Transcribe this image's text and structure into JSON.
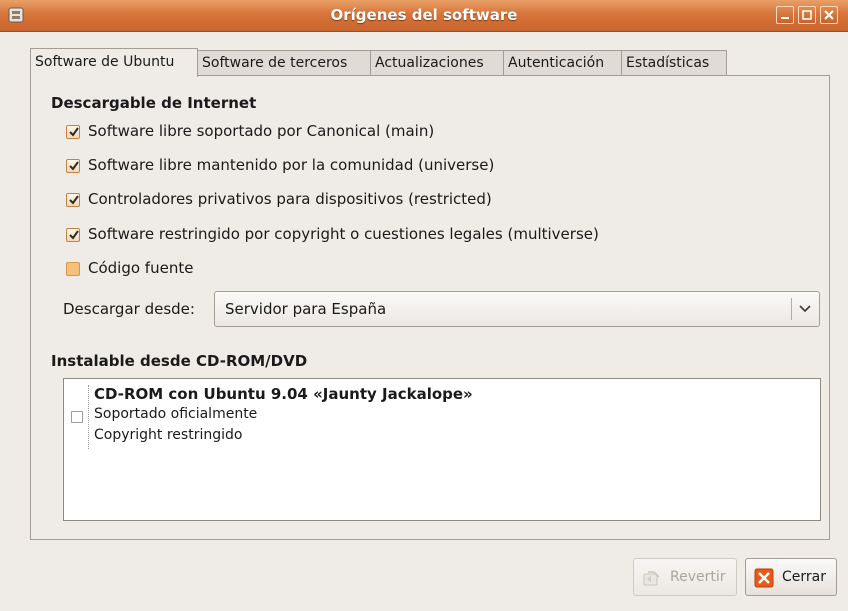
{
  "window": {
    "title": "Orígenes del software",
    "icon": "software-sources-icon",
    "controls": [
      "minimize-icon",
      "maximize-icon",
      "close-icon"
    ]
  },
  "tabs": [
    {
      "label": "Software de Ubuntu",
      "active": true
    },
    {
      "label": "Software de terceros",
      "active": false
    },
    {
      "label": "Actualizaciones",
      "active": false
    },
    {
      "label": "Autenticación",
      "active": false
    },
    {
      "label": "Estadísticas",
      "active": false
    }
  ],
  "internet": {
    "heading": "Descargable de Internet",
    "options": [
      {
        "label": "Software libre soportado por Canonical (main)",
        "checked": true
      },
      {
        "label": "Software libre mantenido por la comunidad (universe)",
        "checked": true
      },
      {
        "label": "Controladores privativos para dispositivos (restricted)",
        "checked": true
      },
      {
        "label": "Software restringido por copyright o cuestiones legales (multiverse)",
        "checked": true
      },
      {
        "label": "Código fuente",
        "checked": false
      }
    ],
    "download_from_label": "Descargar desde:",
    "download_from_value": "Servidor para España"
  },
  "cdrom": {
    "heading": "Instalable desde CD-ROM/DVD",
    "entry": {
      "title": "CD-ROM con Ubuntu 9.04 «Jaunty Jackalope»",
      "line1": "Soportado oficialmente",
      "line2": "Copyright restringido",
      "checked": false
    }
  },
  "buttons": {
    "revert": "Revertir",
    "close": "Cerrar"
  },
  "colors": {
    "titlebar": "#d6743a",
    "window_bg": "#efebe7",
    "checkbox_accent": "#f6c07a",
    "close_icon": "#e85a1a"
  }
}
